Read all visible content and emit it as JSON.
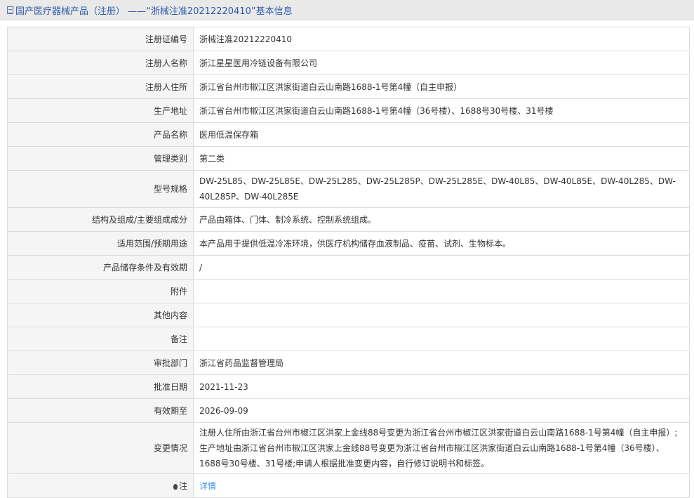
{
  "header": {
    "title": "国产医疗器械产品（注册）  ——“浙械注准20212220410”基本信息"
  },
  "rows": [
    {
      "label": "注册证编号",
      "value": "浙械注准20212220410"
    },
    {
      "label": "注册人名称",
      "value": "浙江星星医用冷链设备有限公司"
    },
    {
      "label": "注册人住所",
      "value": "浙江省台州市椒江区洪家街道白云山南路1688-1号第4幢（自主申报）"
    },
    {
      "label": "生产地址",
      "value": "浙江省台州市椒江区洪家街道白云山南路1688-1号第4幢（36号楼）、1688号30号楼、31号楼"
    },
    {
      "label": "产品名称",
      "value": "医用低温保存箱"
    },
    {
      "label": "管理类别",
      "value": "第二类"
    },
    {
      "label": "型号规格",
      "value": "DW-25L85、DW-25L85E、DW-25L285、DW-25L285P、DW-25L285E、DW-40L85、DW-40L85E、DW-40L285、DW-40L285P、DW-40L285E"
    },
    {
      "label": "结构及组成/主要组成成分",
      "value": "产品由箱体、门体、制冷系统、控制系统组成。"
    },
    {
      "label": "适用范围/预期用途",
      "value": "本产品用于提供低温冷冻环境，供医疗机构储存血液制品、疫苗、试剂、生物标本。"
    },
    {
      "label": "产品储存条件及有效期",
      "value": "/"
    },
    {
      "label": "附件",
      "value": ""
    },
    {
      "label": "其他内容",
      "value": ""
    },
    {
      "label": "备注",
      "value": ""
    },
    {
      "label": "审批部门",
      "value": "浙江省药品监督管理局"
    },
    {
      "label": "批准日期",
      "value": "2021-11-23"
    },
    {
      "label": "有效期至",
      "value": "2026-09-09"
    },
    {
      "label": "变更情况",
      "value": "注册人住所由浙江省台州市椒江区洪家上金线88号变更为浙江省台州市椒江区洪家街道白云山南路1688-1号第4幢（自主申报）;生产地址由浙江省台州市椒江区洪家上金线88号变更为浙江省台州市椒江区洪家街道白云山南路1688-1号第4幢（36号楼）、1688号30号楼、31号楼;申请人根据批准变更内容，自行修订说明书和标签。"
    }
  ],
  "note": {
    "label": "注",
    "link": "详情"
  }
}
